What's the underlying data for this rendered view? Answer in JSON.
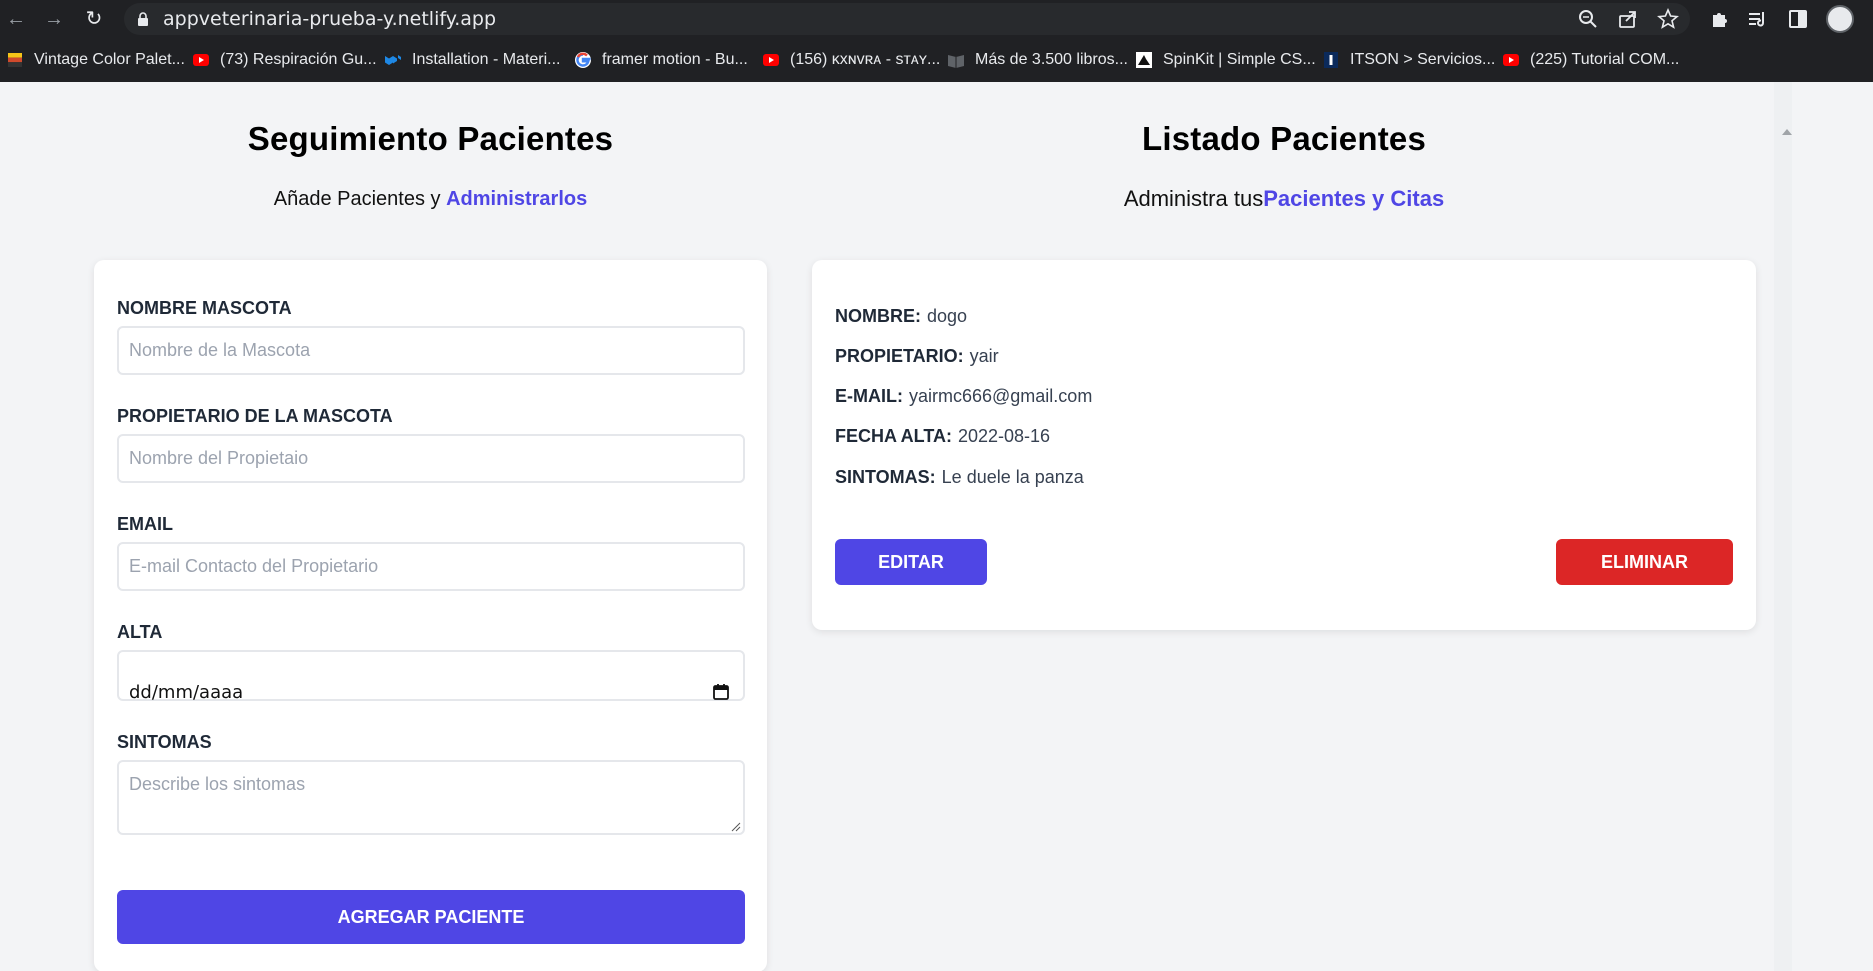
{
  "browser": {
    "url": "appveterinaria-prueba-y.netlify.app",
    "bookmarks": [
      {
        "label": "Vintage Color Palet...",
        "icon": "palette-favicon-icon"
      },
      {
        "label": "(73) Respiración Gu...",
        "icon": "youtube-icon"
      },
      {
        "label": "Installation - Materi...",
        "icon": "mui-icon"
      },
      {
        "label": "framer motion - Bu...",
        "icon": "google-icon"
      },
      {
        "label": "(156) ĸxɴvʀᴀ - sᴛᴀʏ...",
        "icon": "youtube-icon"
      },
      {
        "label": "Más de 3.500 libros...",
        "icon": "book-icon"
      },
      {
        "label": "SpinKit | Simple CS...",
        "icon": "spinkit-icon"
      },
      {
        "label": "ITSON > Servicios...",
        "icon": "itson-icon"
      },
      {
        "label": "(225) Tutorial COM...",
        "icon": "youtube-icon"
      }
    ]
  },
  "form_section": {
    "title": "Seguimiento Pacientes",
    "subtitle_prefix": "Añade Pacientes y ",
    "subtitle_highlight": "Administrarlos",
    "fields": {
      "pet_name": {
        "label": "Nombre Mascota",
        "placeholder": "Nombre de la Mascota"
      },
      "owner": {
        "label": "Propietario de la Mascota",
        "placeholder": "Nombre del Propietaio"
      },
      "email": {
        "label": "Email",
        "placeholder": "E-mail Contacto del Propietario"
      },
      "date": {
        "label": "Alta",
        "value": "dd/mm/aaaa"
      },
      "symptoms": {
        "label": "Sintomas",
        "placeholder": "Describe los sintomas"
      }
    },
    "submit_label": "Agregar Paciente"
  },
  "list_section": {
    "title": "Listado Pacientes",
    "subtitle_prefix": "Administra tus",
    "subtitle_highlight": "Pacientes y Citas",
    "patient": {
      "name_label": "Nombre:",
      "name": "dogo",
      "owner_label": "Propietario:",
      "owner": "yair",
      "email_label": "E-mail:",
      "email": "yairmc666@gmail.com",
      "date_label": "Fecha Alta:",
      "date": "2022-08-16",
      "symptoms_label": "Sintomas:",
      "symptoms": "Le duele la panza"
    },
    "edit_label": "Editar",
    "delete_label": "Eliminar"
  },
  "colors": {
    "accent": "#4f46e5",
    "danger": "#dc2626",
    "background": "#f3f4f6"
  }
}
